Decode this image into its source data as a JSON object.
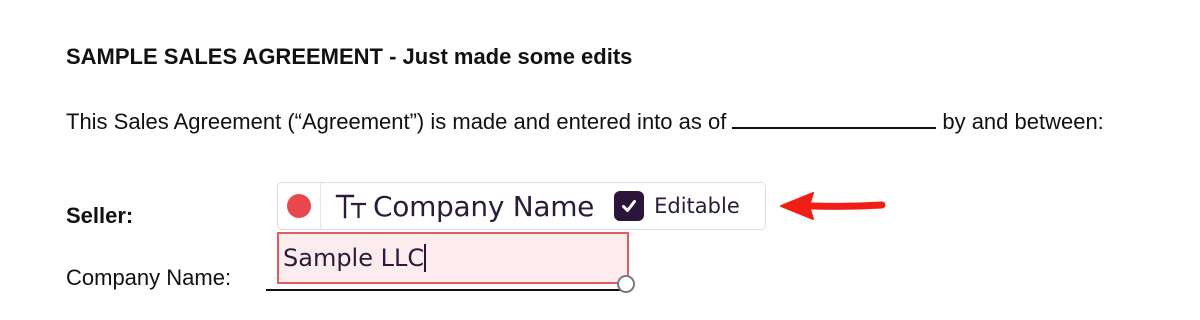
{
  "document": {
    "title": "SAMPLE SALES AGREEMENT - Just made some edits",
    "paragraph_before_blank": "This Sales Agreement (“Agreement”) is made and entered into as of",
    "paragraph_after_blank": "by and between:",
    "seller_label": "Seller:",
    "company_name_label": "Company Name:"
  },
  "field_toolbar": {
    "color_dot": "#e8474d",
    "type_icon": "text-type-icon",
    "field_name": "Company Name",
    "editable_label": "Editable",
    "editable_checked": true
  },
  "field_input": {
    "value": "Sample LLC",
    "background": "#fdeced",
    "border_color": "#e35c60"
  },
  "annotation": {
    "arrow_color": "#f01e14",
    "icon": "arrow-left-icon"
  }
}
